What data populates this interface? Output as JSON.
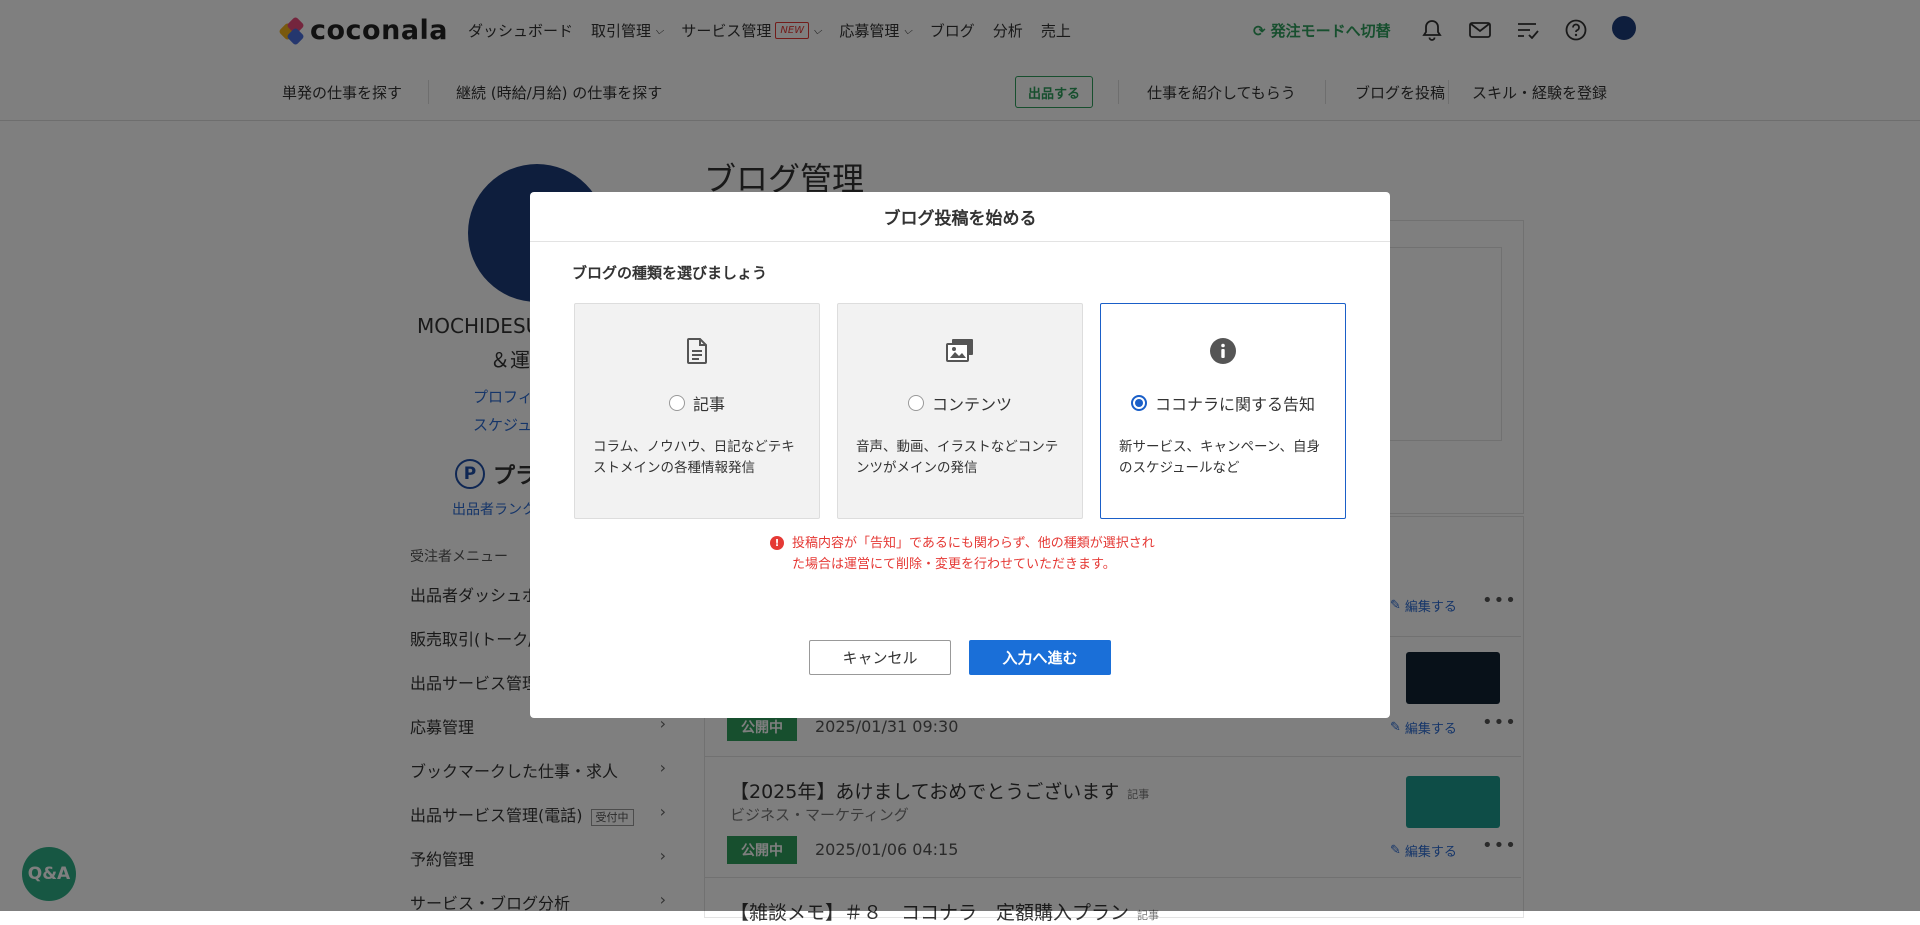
{
  "header": {
    "logo_text": "coconala",
    "nav": [
      {
        "label": "ダッシュボード",
        "dropdown": false
      },
      {
        "label": "取引管理",
        "dropdown": true
      },
      {
        "label": "サービス管理",
        "dropdown": true,
        "badge": "NEW"
      },
      {
        "label": "応募管理",
        "dropdown": true
      },
      {
        "label": "ブログ",
        "dropdown": false
      },
      {
        "label": "分析",
        "dropdown": false
      },
      {
        "label": "売上",
        "dropdown": false
      }
    ],
    "switch_mode": "発注モードへ切替",
    "icons": [
      "bell-icon",
      "mail-icon",
      "list-check-icon",
      "help-icon"
    ]
  },
  "subnav": {
    "find_single": "単発の仕事を探す",
    "find_continuous": "継続 (時給/月給) の仕事を探す",
    "list_button": "出品する",
    "introduce": "仕事を紹介してもらう",
    "post_blog": "ブログを投稿",
    "register_skill": "スキル・経験を登録"
  },
  "profile": {
    "name_line1": "MOCHIDESU",
    "name_line2": "＆運",
    "link_profile": "プロフィ",
    "link_schedule": "スケジュ",
    "rank_label": "プラ",
    "rank_link": "出品者ランク"
  },
  "sidebar": {
    "heading": "受注者メニュー",
    "items": [
      {
        "label": "出品者ダッシュボ",
        "arrow": false
      },
      {
        "label": "販売取引(トーク/",
        "arrow": false
      },
      {
        "label": "出品サービス管理",
        "arrow": false
      },
      {
        "label": "応募管理",
        "arrow": true
      },
      {
        "label": "ブックマークした仕事・求人",
        "arrow": true
      },
      {
        "label": "出品サービス管理(電話)",
        "arrow": true,
        "tag": "受付中"
      },
      {
        "label": "予約管理",
        "arrow": true
      },
      {
        "label": "サービス・ブログ分析",
        "arrow": true
      }
    ]
  },
  "main": {
    "title": "ブログ管理",
    "edit_label": "編集する",
    "articles": [
      {
        "status": "公開中",
        "date": "2025/01/31 09:30"
      },
      {
        "title": "【2025年】あけましておめでとうございます",
        "tag": "記事",
        "category": "ビジネス・マーケティング",
        "status": "公開中",
        "date": "2025/01/06 04:15"
      },
      {
        "title": "【雑談メモ】＃８　ココナラ　定額購入プラン",
        "tag": "記事"
      }
    ]
  },
  "qa_button": "Q&A",
  "modal": {
    "title": "ブログ投稿を始める",
    "subtitle": "ブログの種類を選びましょう",
    "options": [
      {
        "label": "記事",
        "desc": "コラム、ノウハウ、日記などテキストメインの各種情報発信",
        "selected": false,
        "icon": "document-icon"
      },
      {
        "label": "コンテンツ",
        "desc": "音声、動画、イラストなどコンテンツがメインの発信",
        "selected": false,
        "icon": "images-icon"
      },
      {
        "label": "ココナラに関する告知",
        "desc": "新サービス、キャンペーン、自身のスケジュールなど",
        "selected": true,
        "icon": "info-icon"
      }
    ],
    "warning": "投稿内容が「告知」であるにも関わらず、他の種類が選択された場合は運営にて削除・変更を行わせていただきます。",
    "cancel_label": "キャンセル",
    "next_label": "入力へ進む"
  },
  "colors": {
    "accent_blue": "#1a6fd8",
    "brand_green": "#2e9f5d",
    "warning_red": "#e53935"
  }
}
